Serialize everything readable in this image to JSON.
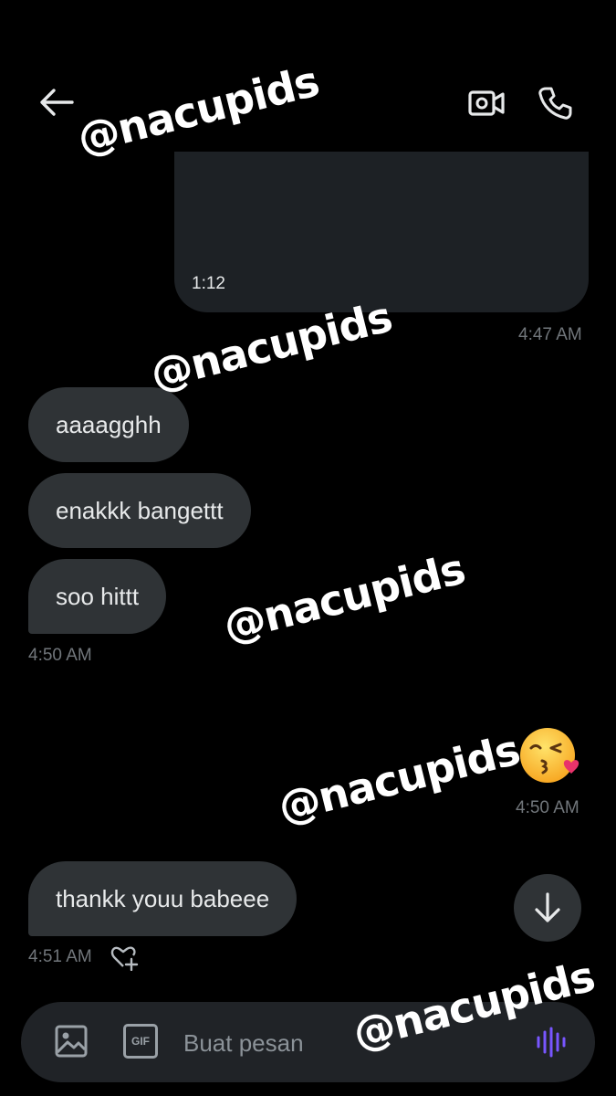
{
  "header": {
    "back_icon": "arrow-left-icon",
    "video_icon": "video-call-icon",
    "call_icon": "phone-icon"
  },
  "messages": {
    "media": {
      "duration": "1:12",
      "time": "4:47 AM"
    },
    "received_group_1": {
      "items": [
        "aaaagghh",
        "enakkk bangettt",
        "soo hittt"
      ],
      "time": "4:50 AM"
    },
    "sent_emoji": {
      "emoji": "😘",
      "time": "4:50 AM"
    },
    "received_2": {
      "text": "thankk youu babeee",
      "time": "4:51 AM"
    }
  },
  "composer": {
    "placeholder": "Buat pesan",
    "media_icon": "image-icon",
    "gif_label": "GIF",
    "voice_icon": "voice-wave-icon"
  },
  "watermark": "@nacupids",
  "colors": {
    "background": "#000000",
    "bubble_received": "#2f3336",
    "timestamp": "#71767b",
    "accent_voice": "#7856ff"
  }
}
